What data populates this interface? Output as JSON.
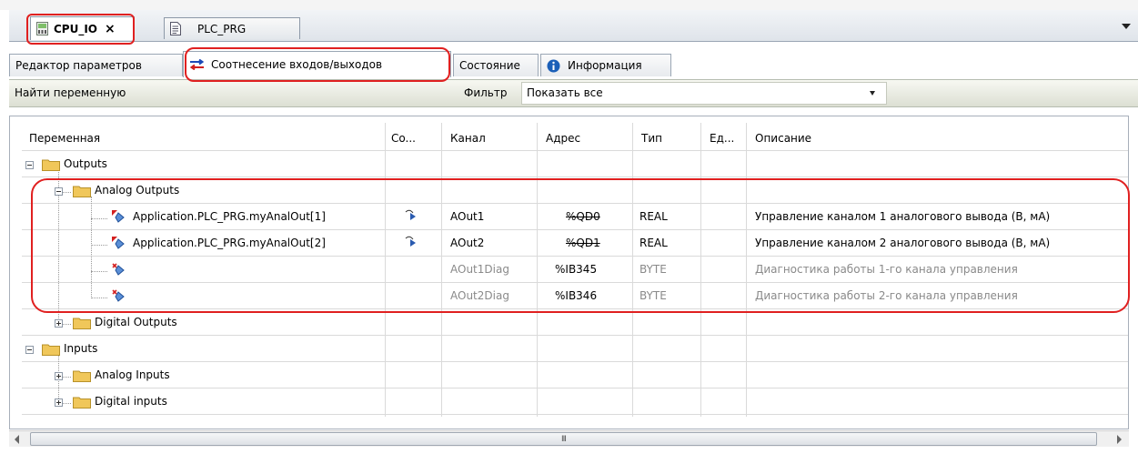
{
  "doc_tabs": [
    {
      "title": "CPU_IO",
      "active": true,
      "close": "×"
    },
    {
      "title": "PLC_PRG",
      "active": false
    }
  ],
  "sub_tabs": [
    {
      "label": "Редактор параметров"
    },
    {
      "label": "Соотнесение входов/выходов",
      "active": true
    },
    {
      "label": "Состояние"
    },
    {
      "label": "Информация"
    }
  ],
  "toolbar": {
    "find_label": "Найти переменную",
    "filter_label": "Фильтр",
    "filter_value": "Показать все"
  },
  "columns": [
    "Переменная",
    "Co...",
    "Канал",
    "Адрес",
    "Тип",
    "Ед...",
    "Описание"
  ],
  "rows": [
    {
      "name": "Outputs"
    },
    {
      "name": "Analog Outputs"
    },
    {
      "name": "Application.PLC_PRG.myAnalOut[1]",
      "channel": "AOut1",
      "address": "%QD0",
      "type": "REAL",
      "description": "Управление каналом 1 аналогового вывода (В, мА)"
    },
    {
      "name": "Application.PLC_PRG.myAnalOut[2]",
      "channel": "AOut2",
      "address": "%QD1",
      "type": "REAL",
      "description": "Управление каналом 2 аналогового вывода (В, мА)"
    },
    {
      "name": "",
      "channel": "AOut1Diag",
      "address": "%IB345",
      "type": "BYTE",
      "description": "Диагностика работы 1-го канала управления"
    },
    {
      "name": "",
      "channel": "AOut2Diag",
      "address": "%IB346",
      "type": "BYTE",
      "description": "Диагностика работы 2-го канала управления"
    },
    {
      "name": "Digital Outputs"
    },
    {
      "name": "Inputs"
    },
    {
      "name": "Analog Inputs"
    },
    {
      "name": "Digital inputs"
    }
  ],
  "scrollbar": {
    "grip": "III"
  },
  "colors": {
    "highlight_annotation": "#e02020",
    "folder": "#e8c04a",
    "info_icon": "#1b5fb8",
    "mapping_icon": "#2a5bb0"
  }
}
